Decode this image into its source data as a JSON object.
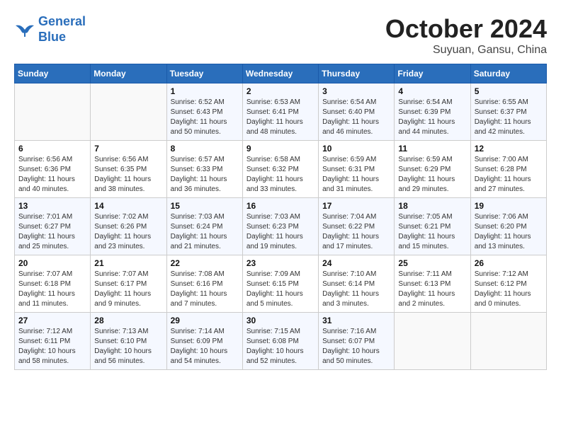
{
  "header": {
    "logo": {
      "line1": "General",
      "line2": "Blue"
    },
    "title": "October 2024",
    "subtitle": "Suyuan, Gansu, China"
  },
  "weekdays": [
    "Sunday",
    "Monday",
    "Tuesday",
    "Wednesday",
    "Thursday",
    "Friday",
    "Saturday"
  ],
  "weeks": [
    [
      null,
      null,
      {
        "day": 1,
        "sunrise": "6:52 AM",
        "sunset": "6:43 PM",
        "daylight": "11 hours and 50 minutes."
      },
      {
        "day": 2,
        "sunrise": "6:53 AM",
        "sunset": "6:41 PM",
        "daylight": "11 hours and 48 minutes."
      },
      {
        "day": 3,
        "sunrise": "6:54 AM",
        "sunset": "6:40 PM",
        "daylight": "11 hours and 46 minutes."
      },
      {
        "day": 4,
        "sunrise": "6:54 AM",
        "sunset": "6:39 PM",
        "daylight": "11 hours and 44 minutes."
      },
      {
        "day": 5,
        "sunrise": "6:55 AM",
        "sunset": "6:37 PM",
        "daylight": "11 hours and 42 minutes."
      }
    ],
    [
      {
        "day": 6,
        "sunrise": "6:56 AM",
        "sunset": "6:36 PM",
        "daylight": "11 hours and 40 minutes."
      },
      {
        "day": 7,
        "sunrise": "6:56 AM",
        "sunset": "6:35 PM",
        "daylight": "11 hours and 38 minutes."
      },
      {
        "day": 8,
        "sunrise": "6:57 AM",
        "sunset": "6:33 PM",
        "daylight": "11 hours and 36 minutes."
      },
      {
        "day": 9,
        "sunrise": "6:58 AM",
        "sunset": "6:32 PM",
        "daylight": "11 hours and 33 minutes."
      },
      {
        "day": 10,
        "sunrise": "6:59 AM",
        "sunset": "6:31 PM",
        "daylight": "11 hours and 31 minutes."
      },
      {
        "day": 11,
        "sunrise": "6:59 AM",
        "sunset": "6:29 PM",
        "daylight": "11 hours and 29 minutes."
      },
      {
        "day": 12,
        "sunrise": "7:00 AM",
        "sunset": "6:28 PM",
        "daylight": "11 hours and 27 minutes."
      }
    ],
    [
      {
        "day": 13,
        "sunrise": "7:01 AM",
        "sunset": "6:27 PM",
        "daylight": "11 hours and 25 minutes."
      },
      {
        "day": 14,
        "sunrise": "7:02 AM",
        "sunset": "6:26 PM",
        "daylight": "11 hours and 23 minutes."
      },
      {
        "day": 15,
        "sunrise": "7:03 AM",
        "sunset": "6:24 PM",
        "daylight": "11 hours and 21 minutes."
      },
      {
        "day": 16,
        "sunrise": "7:03 AM",
        "sunset": "6:23 PM",
        "daylight": "11 hours and 19 minutes."
      },
      {
        "day": 17,
        "sunrise": "7:04 AM",
        "sunset": "6:22 PM",
        "daylight": "11 hours and 17 minutes."
      },
      {
        "day": 18,
        "sunrise": "7:05 AM",
        "sunset": "6:21 PM",
        "daylight": "11 hours and 15 minutes."
      },
      {
        "day": 19,
        "sunrise": "7:06 AM",
        "sunset": "6:20 PM",
        "daylight": "11 hours and 13 minutes."
      }
    ],
    [
      {
        "day": 20,
        "sunrise": "7:07 AM",
        "sunset": "6:18 PM",
        "daylight": "11 hours and 11 minutes."
      },
      {
        "day": 21,
        "sunrise": "7:07 AM",
        "sunset": "6:17 PM",
        "daylight": "11 hours and 9 minutes."
      },
      {
        "day": 22,
        "sunrise": "7:08 AM",
        "sunset": "6:16 PM",
        "daylight": "11 hours and 7 minutes."
      },
      {
        "day": 23,
        "sunrise": "7:09 AM",
        "sunset": "6:15 PM",
        "daylight": "11 hours and 5 minutes."
      },
      {
        "day": 24,
        "sunrise": "7:10 AM",
        "sunset": "6:14 PM",
        "daylight": "11 hours and 3 minutes."
      },
      {
        "day": 25,
        "sunrise": "7:11 AM",
        "sunset": "6:13 PM",
        "daylight": "11 hours and 2 minutes."
      },
      {
        "day": 26,
        "sunrise": "7:12 AM",
        "sunset": "6:12 PM",
        "daylight": "11 hours and 0 minutes."
      }
    ],
    [
      {
        "day": 27,
        "sunrise": "7:12 AM",
        "sunset": "6:11 PM",
        "daylight": "10 hours and 58 minutes."
      },
      {
        "day": 28,
        "sunrise": "7:13 AM",
        "sunset": "6:10 PM",
        "daylight": "10 hours and 56 minutes."
      },
      {
        "day": 29,
        "sunrise": "7:14 AM",
        "sunset": "6:09 PM",
        "daylight": "10 hours and 54 minutes."
      },
      {
        "day": 30,
        "sunrise": "7:15 AM",
        "sunset": "6:08 PM",
        "daylight": "10 hours and 52 minutes."
      },
      {
        "day": 31,
        "sunrise": "7:16 AM",
        "sunset": "6:07 PM",
        "daylight": "10 hours and 50 minutes."
      },
      null,
      null
    ]
  ]
}
